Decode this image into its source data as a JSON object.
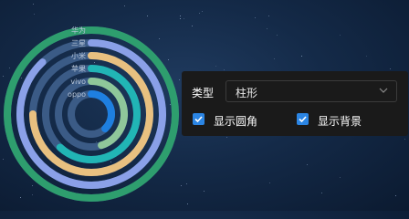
{
  "chart_data": {
    "type": "bar",
    "polar": true,
    "categories": [
      "华为",
      "三星",
      "小米",
      "苹果",
      "vivo",
      "oppo"
    ],
    "series": [
      {
        "values": [
          100,
          88,
          75,
          62,
          45,
          38
        ]
      }
    ],
    "max": 100,
    "colors": [
      "#2e9e6e",
      "#8aa0e8",
      "#e8c080",
      "#21b5b5",
      "#8fc79a",
      "#1e7fe0"
    ],
    "track_color": "#3b5b86",
    "label_color": "#b9c7da"
  },
  "controls": {
    "type_label": "类型",
    "type_value": "柱形",
    "round_corner_label": "显示圆角",
    "show_background_label": "显示背景",
    "round_corner_checked": true,
    "show_background_checked": true
  }
}
